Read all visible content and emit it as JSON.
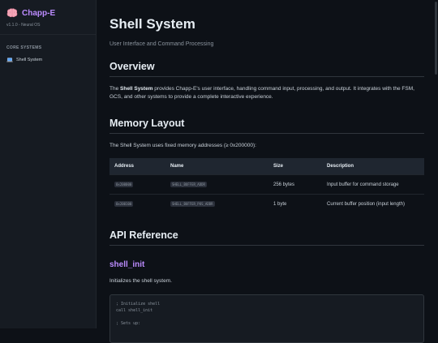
{
  "sidebar": {
    "brand_title": "Chapp-E",
    "brand_subtitle": "v1.1.0 - Neural OS",
    "section_label": "CORE SYSTEMS",
    "items": [
      {
        "label": "Shell System",
        "icon": "laptop-icon"
      }
    ]
  },
  "main": {
    "title": "Shell System",
    "subtitle": "User Interface and Command Processing",
    "overview": {
      "heading": "Overview",
      "strong": "Shell System",
      "text_before": "The ",
      "text_after": " provides Chapp-E's user interface, handling command input, processing, and output. It integrates with the FSM, GCS, and other systems to provide a complete interactive experience."
    },
    "memory": {
      "heading": "Memory Layout",
      "intro": "The Shell System uses fixed memory addresses (≥ 0x200000):",
      "columns": [
        "Address",
        "Name",
        "Size",
        "Description"
      ],
      "rows": [
        {
          "address": "0x200000",
          "name": "SHELL_BUFFER_ADDR",
          "size": "256 bytes",
          "description": "Input buffer for command storage"
        },
        {
          "address": "0x200100",
          "name": "SHELL_BUFFER_POS_ADDR",
          "size": "1 byte",
          "description": "Current buffer position (input length)"
        }
      ]
    },
    "api": {
      "heading": "API Reference",
      "function_name": "shell_init",
      "function_desc": "Initializes the shell system.",
      "code": "; Initialize shell\ncall shell_init\n\n; Sets up:"
    }
  },
  "colors": {
    "background": "#0d1117",
    "sidebar": "#161b22",
    "accent": "#bc8cff"
  }
}
